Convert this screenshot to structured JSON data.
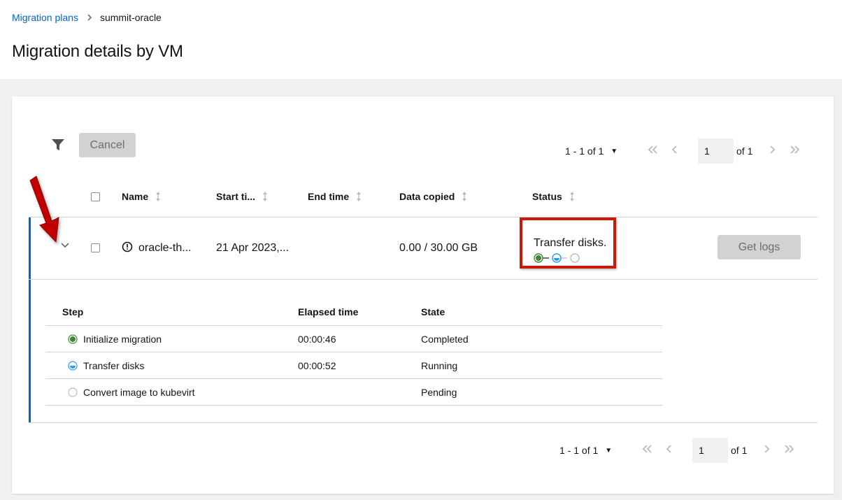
{
  "breadcrumb": {
    "parent": "Migration plans",
    "current": "summit-oracle"
  },
  "page": {
    "title": "Migration details by VM"
  },
  "toolbar": {
    "cancel_label": "Cancel"
  },
  "pagination_top": {
    "range": "1 - 1 of 1",
    "page": "1",
    "of": "of 1"
  },
  "pagination_bottom": {
    "range": "1 - 1 of 1",
    "page": "1",
    "of": "of 1"
  },
  "table": {
    "columns": {
      "name": "Name",
      "start": "Start ti...",
      "end": "End time",
      "data_copied": "Data copied",
      "status": "Status"
    },
    "rows": [
      {
        "name": "oracle-th...",
        "start_time": "21 Apr 2023,...",
        "end_time": "",
        "data_copied": "0.00 / 30.00 GB",
        "status": "Transfer disks.",
        "get_logs_label": "Get logs"
      }
    ]
  },
  "details": {
    "columns": {
      "step": "Step",
      "elapsed": "Elapsed time",
      "state": "State"
    },
    "steps": [
      {
        "label": "Initialize migration",
        "elapsed": "00:00:46",
        "state": "Completed",
        "status_icon": "completed-circle-icon"
      },
      {
        "label": "Transfer disks",
        "elapsed": "00:00:52",
        "state": "Running",
        "status_icon": "running-circle-icon"
      },
      {
        "label": "Convert image to kubevirt",
        "elapsed": "",
        "state": "Pending",
        "status_icon": "pending-circle-icon"
      }
    ]
  },
  "colors": {
    "link": "#0066cc",
    "success": "#3e8635",
    "running": "#2b9af3",
    "highlight": "#c9190b"
  }
}
